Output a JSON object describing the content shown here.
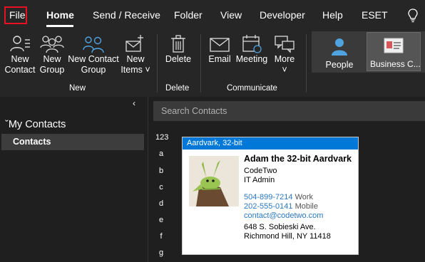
{
  "menu": {
    "items": [
      "File",
      "Home",
      "Send / Receive",
      "Folder",
      "View",
      "Developer",
      "Help",
      "ESET"
    ],
    "active": "Home",
    "highlighted": "File"
  },
  "ribbon": {
    "new_group": {
      "label": "New",
      "buttons": [
        {
          "l1": "New",
          "l2": "Contact",
          "icon": "person-icon"
        },
        {
          "l1": "New",
          "l2": "Group",
          "icon": "people-icon"
        },
        {
          "l1": "New Contact",
          "l2": "Group",
          "icon": "contact-group-icon"
        },
        {
          "l1": "New",
          "l2": "Items ˅",
          "icon": "new-items-icon"
        }
      ]
    },
    "delete_group": {
      "label": "Delete",
      "buttons": [
        {
          "l1": "Delete",
          "icon": "trash-icon"
        }
      ]
    },
    "communicate_group": {
      "label": "Communicate",
      "buttons": [
        {
          "l1": "Email",
          "icon": "envelope-icon"
        },
        {
          "l1": "Meeting",
          "icon": "calendar-icon"
        },
        {
          "l1": "More",
          "l2": "˅",
          "icon": "chat-icon"
        }
      ]
    },
    "current_view": {
      "buttons": [
        {
          "l1": "People",
          "icon": "person-icon"
        },
        {
          "l1": "Business C...",
          "icon": "business-card-icon",
          "selected": true
        }
      ]
    }
  },
  "nav": {
    "collapse": "‹",
    "section": "My Contacts",
    "items": [
      {
        "label": "Contacts",
        "selected": true
      }
    ]
  },
  "search": {
    "placeholder": "Search Contacts"
  },
  "index": [
    "123",
    "a",
    "b",
    "c",
    "d",
    "e",
    "f",
    "g"
  ],
  "card": {
    "header": "Aardvark, 32-bit",
    "name": "Adam the 32-bit Aardvark",
    "company": "CodeTwo",
    "title": "IT Admin",
    "phones": [
      {
        "number": "504-899-7214",
        "type": "Work"
      },
      {
        "number": "202-555-0141",
        "type": "Mobile"
      }
    ],
    "email": "contact@codetwo.com",
    "address_line1": "648 S. Sobieski Ave.",
    "address_line2": "Richmond Hill, NY 11418"
  },
  "colors": {
    "accent": "#0078d7",
    "highlight_border": "#e81123",
    "link": "#2b79c2"
  }
}
